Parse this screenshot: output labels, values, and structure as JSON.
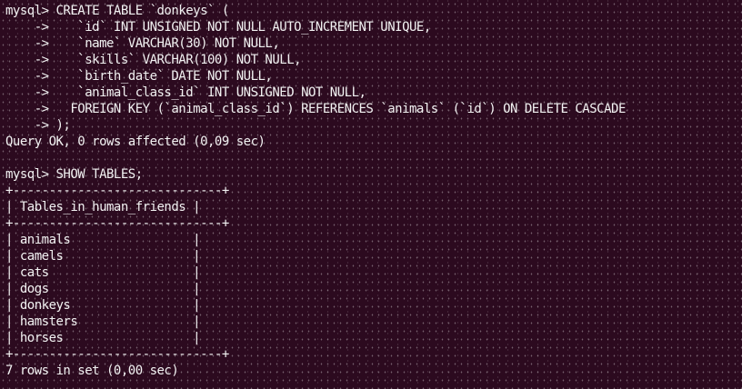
{
  "terminal": {
    "lines": [
      "mysql> CREATE TABLE `donkeys` (",
      "    ->    `id` INT UNSIGNED NOT NULL AUTO_INCREMENT UNIQUE,",
      "    ->    `name` VARCHAR(30) NOT NULL,",
      "    ->    `skills` VARCHAR(100) NOT NULL,",
      "    ->    `birth_date` DATE NOT NULL,",
      "    ->    `animal_class_id` INT UNSIGNED NOT NULL,",
      "    ->   FOREIGN KEY (`animal_class_id`) REFERENCES `animals` (`id`) ON DELETE CASCADE",
      "    -> );",
      "Query OK, 0 rows affected (0,09 sec)",
      "",
      "mysql> SHOW TABLES;",
      "+-----------------------------+",
      "| Tables_in_human_friends |",
      "+-----------------------------+",
      "| animals                 |",
      "| camels                  |",
      "| cats                    |",
      "| dogs                    |",
      "| donkeys                 |",
      "| hamsters                |",
      "| horses                  |",
      "+-----------------------------+",
      "7 rows in set (0,00 sec)"
    ]
  }
}
